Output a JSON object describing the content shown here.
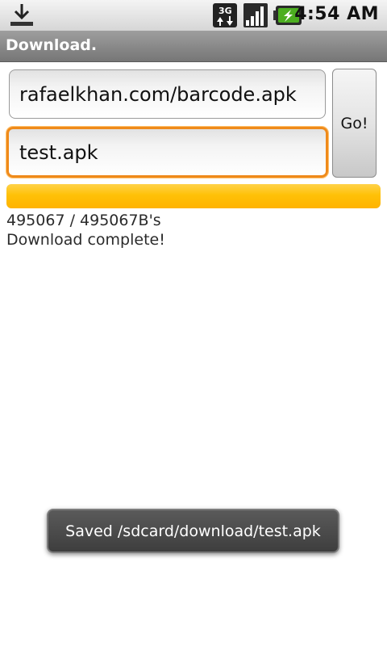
{
  "status_bar": {
    "time": "4:54 AM",
    "icons": [
      "download-icon",
      "3g-data-icon",
      "signal-icon",
      "battery-charging-icon"
    ]
  },
  "title_bar": {
    "title": "Download."
  },
  "form": {
    "url_value": "rafaelkhan.com/barcode.apk",
    "filename_value": "test.apk",
    "go_label": "Go!"
  },
  "progress": {
    "fraction": 1.0,
    "bytes_text": "495067 / 495067B's",
    "status_text": "Download complete!"
  },
  "toast": {
    "message": "Saved /sdcard/download/test.apk"
  },
  "colors": {
    "progress_fill": "#ffc107",
    "focus_border": "#ef8a1a"
  }
}
